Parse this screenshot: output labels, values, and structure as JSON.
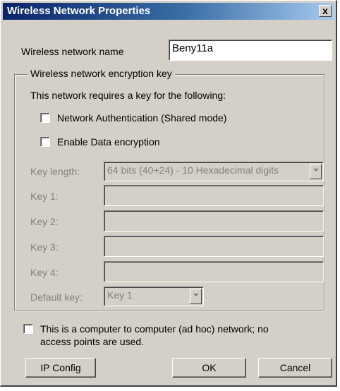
{
  "window": {
    "title": "Wireless Network Properties",
    "close_glyph": "x"
  },
  "network_name": {
    "label": "Wireless network name",
    "value": "Beny11a"
  },
  "encryption_group": {
    "legend": "Wireless network encryption key",
    "intro": "This network requires a key for the following:",
    "auth_checkbox_label": "Network  Authentication (Shared mode)",
    "auth_checked": false,
    "encryption_checkbox_label": "Enable Data encryption",
    "encryption_checked": false,
    "key_length": {
      "label": "Key length:",
      "value": "64 bits (40+24) - 10 Hexadecimal digits"
    },
    "keys": [
      {
        "label": "Key 1:",
        "value": ""
      },
      {
        "label": "Key 2:",
        "value": ""
      },
      {
        "label": "Key 3:",
        "value": ""
      },
      {
        "label": "Key 4:",
        "value": ""
      }
    ],
    "default_key": {
      "label": "Default key:",
      "value": "Key 1"
    }
  },
  "adhoc": {
    "line1": "This is a computer to computer (ad hoc) network; no",
    "line2": "access points are used.",
    "checked": false
  },
  "buttons": {
    "ip_config": "IP Config",
    "ok": "OK",
    "cancel": "Cancel"
  }
}
